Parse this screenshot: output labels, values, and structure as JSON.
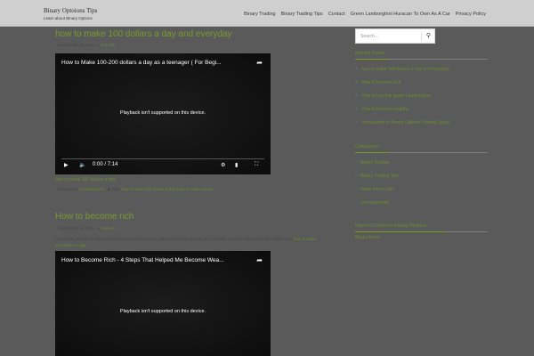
{
  "site": {
    "title": "Binary Optoions Tips",
    "tagline": "Learn about Binary Options"
  },
  "nav": [
    "Binary Trading",
    "Binary Trading Tips",
    "Contact",
    "Green Lamborghini Huracan To Own As A Car",
    "Privacy Policy"
  ],
  "posts": [
    {
      "title": "how to make 100 dollars a day and everyday",
      "date": "September 23, 2021",
      "author": "Sue Hill",
      "video_title": "How to Make 100-200 dollars a day as a teenager ( For Begi...",
      "video_message": "Playback isn't supported on this device.",
      "video_time": "0:00 / 7:14",
      "link": "how to make 100 dollars a day",
      "category_prefix": "Categories",
      "category": "Uncategorized",
      "tags_prefix": "Tags",
      "tags": "how to make 100 dollars a day, how to make money"
    },
    {
      "title": "How to become rich",
      "date": "September 22, 2021",
      "author": "Sue Hill",
      "excerpt": "How to become rich? Having a few hundred in the money, financial stability, wealthy do I to make you rich. Hundred dollar a day? How",
      "excerpt_link": "how to make 100 dollars a day",
      "video_title": "How to Become Rich - 4 Steps That Helped Me Become Wea...",
      "video_message": "Playback isn't supported on this device."
    }
  ],
  "sidebar": {
    "search_placeholder": "Search...",
    "recent_title": "Recent Posts",
    "recent": [
      "how to make 100 dollars a day and everyday",
      "How to become rich",
      "How to buy this green Lamborghini",
      "How to become wealthy",
      "Introduction to Binary Options Trading Signal"
    ],
    "categories_title": "Categories",
    "categories": [
      "Binary Trading",
      "Binary Trading Tips",
      "make money tips",
      "Uncategorized"
    ],
    "partner_title": "Internet Common Binary Brokers",
    "partner": "Binary Forex"
  }
}
